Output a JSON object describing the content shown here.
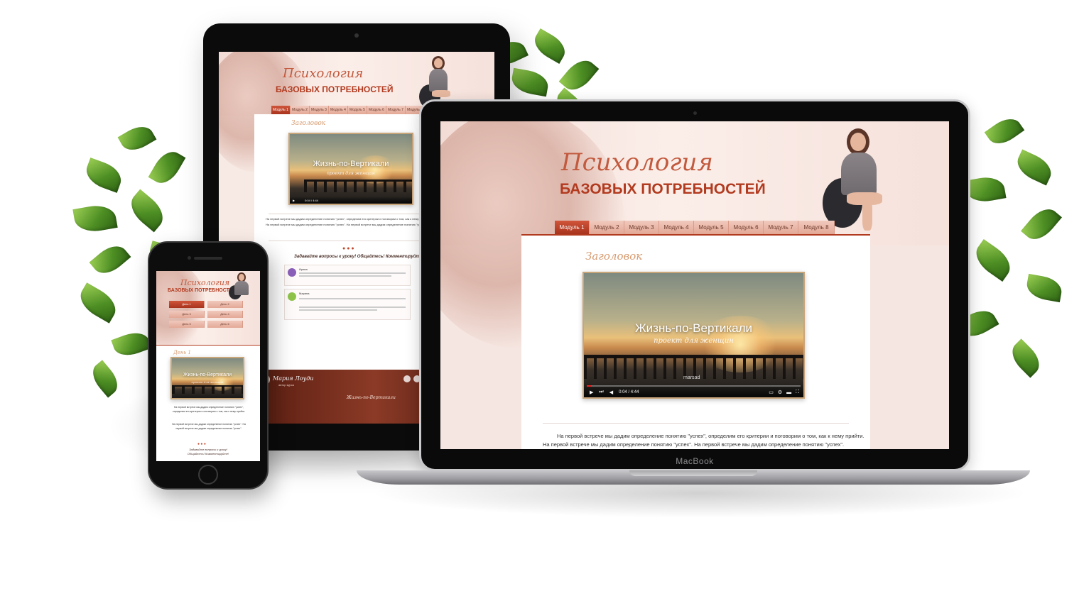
{
  "site": {
    "script_title": "Психология",
    "caps_title": "БАЗОВЫХ ПОТРЕБНОСТЕЙ",
    "section_heading": "Заголовок",
    "video_title": "Жизнь-по-Вертикали",
    "video_subtitle": "проект для женщин",
    "video_time": "0:04 / 4:44",
    "video_overlay": "marsad",
    "paragraph_1": "На первой встрече мы дадим определение понятию \"успех\", определим его критерии и поговорим о том, как к нему прийти.",
    "paragraph_2": "На первой встрече мы дадим определение понятию \"успех\". На первой встрече мы дадим определение понятию \"успех\"."
  },
  "laptop": {
    "brand": "MacBook",
    "tabs": [
      "Модуль 1",
      "Модуль 2",
      "Модуль 3",
      "Модуль 4",
      "Модуль 5",
      "Модуль 6",
      "Модуль 7",
      "Модуль 8"
    ],
    "active_tab": 0
  },
  "tablet": {
    "tabs": [
      "Модуль 1",
      "Модуль 2",
      "Модуль 3",
      "Модуль 4",
      "Модуль 5",
      "Модуль 6",
      "Модуль 7",
      "Модуль 8"
    ],
    "comments_prompt": "Задавайте вопросы к уроку! Общайтесь! Комментируйте!",
    "comment_1_author": "Ирина",
    "comment_2_author": "Марина",
    "author_name": "Мария Лоуди",
    "author_role": "автор курса",
    "project_name": "Жизнь-по-Вертикали"
  },
  "phone": {
    "days": [
      "День 1",
      "День 2",
      "День 3",
      "День 4",
      "День 5",
      "День 6"
    ],
    "day_heading": "День 1",
    "comments_prompt_1": "Задавайте вопросы к уроку!",
    "comments_prompt_2": "Общайтесь! Комментируйте!"
  },
  "colors": {
    "accent": "#b23a1f",
    "tab_active": "#c0472b",
    "tab": "#e7b0a0",
    "heading_gold": "#d79a6f"
  }
}
